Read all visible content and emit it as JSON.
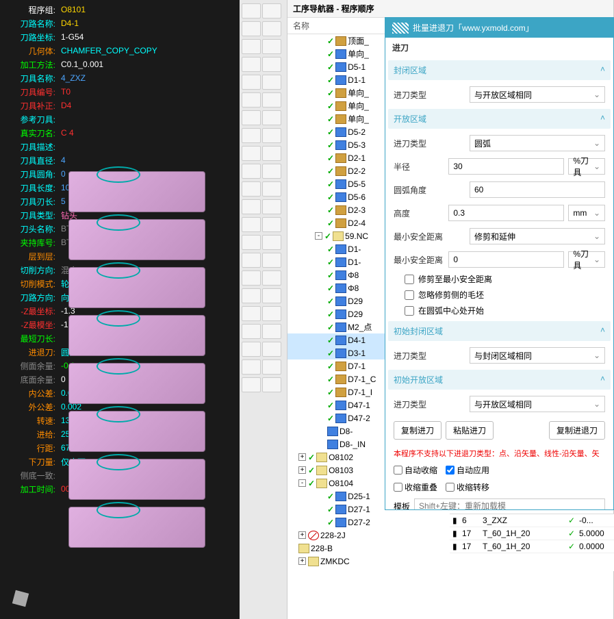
{
  "info": {
    "rows": [
      {
        "label": "程序组:",
        "value": "O8101",
        "lc": "c-white",
        "vc": "c-yellow"
      },
      {
        "label": "刀路名称:",
        "value": "D4-1",
        "lc": "c-cyan",
        "vc": "c-yellow"
      },
      {
        "label": "刀路坐标:",
        "value": "1-G54",
        "lc": "c-cyan",
        "vc": "c-white"
      },
      {
        "label": "几何体:",
        "value": "CHAMFER_COPY_COPY",
        "lc": "c-orange",
        "vc": "c-cyan"
      },
      {
        "label": "加工方法:",
        "value": "C0.1_0.001",
        "lc": "c-green",
        "vc": "c-white"
      },
      {
        "label": "刀具名称:",
        "value": "4_ZXZ",
        "lc": "c-cyan",
        "vc": "c-blue"
      },
      {
        "label": "刀具编号:",
        "value": "T0",
        "lc": "c-red",
        "vc": "c-red"
      },
      {
        "label": "刀具补正:",
        "value": "D4",
        "lc": "c-red",
        "vc": "c-red"
      },
      {
        "label": "参考刀具:",
        "value": "",
        "lc": "c-cyan",
        "vc": ""
      },
      {
        "label": "真实刀名:",
        "value": "C 4",
        "lc": "c-green",
        "vc": "c-red"
      },
      {
        "label": "刀具描述:",
        "value": "",
        "lc": "c-cyan",
        "vc": ""
      },
      {
        "label": "刀具直径:",
        "value": "4",
        "lc": "c-cyan",
        "vc": "c-blue"
      },
      {
        "label": "刀具圆角:",
        "value": "0",
        "lc": "c-cyan",
        "vc": "c-blue"
      },
      {
        "label": "刀具长度:",
        "value": "10",
        "lc": "c-cyan",
        "vc": "c-blue"
      },
      {
        "label": "刀具刃长:",
        "value": "5",
        "lc": "c-cyan",
        "vc": "c-blue"
      },
      {
        "label": "刀具类型:",
        "value": "钻头",
        "lc": "c-cyan",
        "vc": "c-pink"
      },
      {
        "label": "刀头名称:",
        "value": "BT30_SK_88h_",
        "lc": "c-cyan",
        "vc": "c-gray"
      },
      {
        "label": "夹持库号:",
        "value": "BT30_",
        "lc": "c-green",
        "vc": "c-gray"
      },
      {
        "label": "层到层:",
        "value": "",
        "lc": "c-orange",
        "vc": ""
      },
      {
        "label": "切削方向:",
        "value": "混合",
        "lc": "c-cyan",
        "vc": "c-gray"
      },
      {
        "label": "切削模式:",
        "value": "轮廓",
        "lc": "c-orange",
        "vc": "c-cyan"
      },
      {
        "label": "刀路方向:",
        "value": "向外",
        "lc": "c-cyan",
        "vc": "c-cyan"
      },
      {
        "label": "-Z最坐标:",
        "value": "-1.3",
        "lc": "c-red",
        "vc": "c-white"
      },
      {
        "label": "-Z最模坐:",
        "value": "-1.3",
        "lc": "c-red",
        "vc": "c-white"
      },
      {
        "label": "最短刀长:",
        "value": "",
        "lc": "c-green",
        "vc": ""
      },
      {
        "label": "进退刀:",
        "value": "圆弧",
        "lc": "c-orange",
        "vc": "c-cyan"
      },
      {
        "label": "侧面余量:",
        "value": "-0.1",
        "lc": "c-gray",
        "vc": "c-green"
      },
      {
        "label": "底面余量:",
        "value": "0",
        "lc": "c-gray",
        "vc": "c-white"
      },
      {
        "label": "内公差:",
        "value": "0.002",
        "lc": "c-orange",
        "vc": "c-cyan"
      },
      {
        "label": "外公差:",
        "value": "0.002",
        "lc": "c-orange",
        "vc": "c-cyan"
      },
      {
        "label": "转速:",
        "value": "13500",
        "lc": "c-orange",
        "vc": "c-cyan"
      },
      {
        "label": "进给:",
        "value": "2500",
        "lc": "c-orange",
        "vc": "c-cyan"
      },
      {
        "label": "行距:",
        "value": "67%",
        "lc": "c-orange",
        "vc": "c-cyan"
      },
      {
        "label": "下刀量:",
        "value": "仅底面",
        "lc": "c-orange",
        "vc": "c-cyan"
      },
      {
        "label": "侧底一致:",
        "value": "",
        "lc": "c-gray",
        "vc": ""
      },
      {
        "label": "加工时间:",
        "value": "00:00:03",
        "lc": "c-green",
        "vc": "c-red"
      }
    ]
  },
  "navigator": {
    "title": "工序导航器 - 程序顺序",
    "colhead": "名称",
    "items": [
      {
        "lvl": 2,
        "chk": "✓",
        "ico": "ico-op",
        "label": "顶面_"
      },
      {
        "lvl": 2,
        "chk": "✓",
        "ico": "ico-cut",
        "label": "单向_"
      },
      {
        "lvl": 2,
        "chk": "✓",
        "ico": "ico-cut",
        "label": "D5-1"
      },
      {
        "lvl": 2,
        "chk": "✓",
        "ico": "ico-cut",
        "label": "D1-1"
      },
      {
        "lvl": 2,
        "chk": "✓",
        "ico": "ico-op",
        "label": "单向_"
      },
      {
        "lvl": 2,
        "chk": "✓",
        "ico": "ico-op",
        "label": "单向_"
      },
      {
        "lvl": 2,
        "chk": "✓",
        "ico": "ico-op",
        "label": "单向_"
      },
      {
        "lvl": 2,
        "chk": "✓",
        "ico": "ico-cut",
        "label": "D5-2"
      },
      {
        "lvl": 2,
        "chk": "✓",
        "ico": "ico-cut",
        "label": "D5-3"
      },
      {
        "lvl": 2,
        "chk": "✓",
        "ico": "ico-op",
        "label": "D2-1"
      },
      {
        "lvl": 2,
        "chk": "✓",
        "ico": "ico-op",
        "label": "D2-2"
      },
      {
        "lvl": 2,
        "chk": "✓",
        "ico": "ico-cut",
        "label": "D5-5"
      },
      {
        "lvl": 2,
        "chk": "✓",
        "ico": "ico-cut",
        "label": "D5-6"
      },
      {
        "lvl": 2,
        "chk": "✓",
        "ico": "ico-op",
        "label": "D2-3"
      },
      {
        "lvl": 2,
        "chk": "✓",
        "ico": "ico-op",
        "label": "D2-4"
      },
      {
        "lvl": 1,
        "chk": "✓",
        "ico": "ico-prog",
        "label": "59.NC",
        "exp": "-"
      },
      {
        "lvl": 2,
        "chk": "✓",
        "ico": "ico-cut",
        "label": "D1-"
      },
      {
        "lvl": 2,
        "chk": "✓",
        "ico": "ico-cut",
        "label": "D1-"
      },
      {
        "lvl": 2,
        "chk": "✓",
        "ico": "ico-cut",
        "label": "Φ8"
      },
      {
        "lvl": 2,
        "chk": "✓",
        "ico": "ico-cut",
        "label": "Φ8"
      },
      {
        "lvl": 2,
        "chk": "✓",
        "ico": "ico-cut",
        "label": "D29"
      },
      {
        "lvl": 2,
        "chk": "✓",
        "ico": "ico-cut",
        "label": "D29"
      },
      {
        "lvl": 2,
        "chk": "✓",
        "ico": "ico-cut",
        "label": "M2_点"
      },
      {
        "lvl": 2,
        "chk": "✓",
        "ico": "ico-cut",
        "label": "D4-1",
        "sel": true
      },
      {
        "lvl": 2,
        "chk": "✓",
        "ico": "ico-cut",
        "label": "D3-1",
        "sel": true
      },
      {
        "lvl": 2,
        "chk": "✓",
        "ico": "ico-op",
        "label": "D7-1"
      },
      {
        "lvl": 2,
        "chk": "✓",
        "ico": "ico-op",
        "label": "D7-1_C"
      },
      {
        "lvl": 2,
        "chk": "✓",
        "ico": "ico-op",
        "label": "D7-1_I"
      },
      {
        "lvl": 2,
        "chk": "✓",
        "ico": "ico-cut",
        "label": "D47-1"
      },
      {
        "lvl": 2,
        "chk": "✓",
        "ico": "ico-cut",
        "label": "D47-2"
      },
      {
        "lvl": 2,
        "chk": "",
        "ico": "ico-cut",
        "label": "D8-"
      },
      {
        "lvl": 2,
        "chk": "",
        "ico": "ico-cut",
        "label": "D8-_IN"
      },
      {
        "lvl": 0,
        "chk": "✓",
        "ico": "ico-prog",
        "label": "O8102",
        "exp": "+"
      },
      {
        "lvl": 0,
        "chk": "✓",
        "ico": "ico-prog",
        "label": "O8103",
        "exp": "+"
      },
      {
        "lvl": 0,
        "chk": "✓",
        "ico": "ico-prog",
        "label": "O8104",
        "exp": "-"
      },
      {
        "lvl": 2,
        "chk": "✓",
        "ico": "ico-cut",
        "label": "D25-1"
      },
      {
        "lvl": 2,
        "chk": "✓",
        "ico": "ico-cut",
        "label": "D27-1"
      },
      {
        "lvl": 2,
        "chk": "✓",
        "ico": "ico-cut",
        "label": "D27-2"
      },
      {
        "lvl": 0,
        "chk": "",
        "ico": "ico-forbid",
        "label": "228-2J",
        "exp": "+"
      },
      {
        "lvl": 0,
        "chk": "",
        "ico": "ico-prog",
        "label": "228-B",
        "exp": ""
      },
      {
        "lvl": 0,
        "chk": "",
        "ico": "ico-prog",
        "label": "ZMKDC",
        "exp": "+"
      }
    ]
  },
  "dialog": {
    "title": "批量进退刀「www.yxmold.com」",
    "tab": "进刀",
    "sections": {
      "closed": {
        "head": "封闭区域",
        "field": "进刀类型",
        "value": "与开放区域相同"
      },
      "open": {
        "head": "开放区域",
        "type": {
          "label": "进刀类型",
          "value": "圆弧"
        },
        "radius": {
          "label": "半径",
          "value": "30",
          "unit": "%刀具"
        },
        "angle": {
          "label": "圆弧角度",
          "value": "60"
        },
        "height": {
          "label": "高度",
          "value": "0.3",
          "unit": "mm"
        },
        "minsafe": {
          "label": "最小安全距离",
          "value": "修剪和延伸"
        },
        "minsafedist": {
          "label": "最小安全距离",
          "value": "0",
          "unit": "%刀具"
        },
        "chk1": "修剪至最小安全距离",
        "chk2": "忽略修剪侧的毛坯",
        "chk3": "在圆弧中心处开始"
      },
      "initclosed": {
        "head": "初始封闭区域",
        "label": "进刀类型",
        "value": "与封闭区域相同"
      },
      "initopen": {
        "head": "初始开放区域",
        "label": "进刀类型",
        "value": "与开放区域相同"
      }
    },
    "buttons": {
      "copyin": "复制进刀",
      "pastein": "粘贴进刀",
      "copyout": "复制进退刀"
    },
    "warning": "本程序不支持以下进退刀类型：点、沿矢量、线性-沿矢量、矢",
    "opts": {
      "autoshrink": "自动收缩",
      "autoapply": "自动应用",
      "shrinkoverlap": "收缩重叠",
      "shrinktransfer": "收缩转移"
    },
    "template": {
      "label": "模板",
      "placeholder": "Shift+左键：重新加载模"
    }
  },
  "details": {
    "rows": [
      {
        "c2": "6",
        "c3": "3_ZXZ",
        "c5": "-0..."
      },
      {
        "c2": "17",
        "c3": "T_60_1H_20",
        "c5": "5.0000"
      },
      {
        "c2": "17",
        "c3": "T_60_1H_20",
        "c5": "0.0000"
      }
    ]
  }
}
